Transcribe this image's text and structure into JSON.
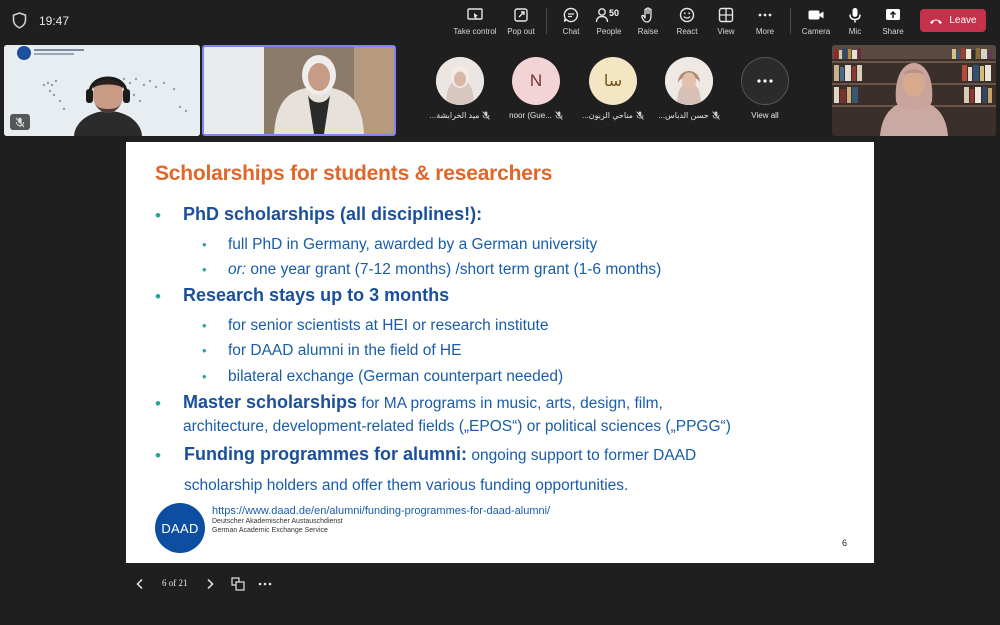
{
  "status": {
    "time": "19:47"
  },
  "toolbar": {
    "take_control": "Take control",
    "pop_out": "Pop out",
    "chat": "Chat",
    "people": "People",
    "people_count": "50",
    "raise": "Raise",
    "react": "React",
    "view": "View",
    "more": "More",
    "camera": "Camera",
    "mic": "Mic",
    "share": "Share",
    "leave": "Leave"
  },
  "participants": [
    {
      "name": "...ميد الخرابشة",
      "kind": "photo"
    },
    {
      "name": "noor (Gue...",
      "kind": "initial",
      "initial": "N"
    },
    {
      "name": "...مناحي الزبون",
      "kind": "initial",
      "initial": "سا"
    },
    {
      "name": "...حسن الدباس",
      "kind": "photo"
    },
    {
      "name": "View all",
      "kind": "more"
    }
  ],
  "slide": {
    "title": "Scholarships for students & researchers",
    "items": [
      {
        "level": 1,
        "text": "PhD scholarships (all disciplines!):"
      },
      {
        "level": 2,
        "text": " full PhD in Germany, awarded by a German university"
      },
      {
        "level": 2,
        "italic_prefix": "or:",
        "text": " one year grant (7-12 months) /short term grant (1-6 months)"
      },
      {
        "level": 1,
        "text": "Research stays up to 3 months"
      },
      {
        "level": 2,
        "text": "for senior scientists at HEI or research institute"
      },
      {
        "level": 2,
        "text": "for DAAD alumni in the field of HE"
      },
      {
        "level": 2,
        "text": "bilateral exchange (German counterpart needed)"
      },
      {
        "level": 1,
        "bold": "Master scholarships",
        "text": " for MA programs in music, arts, design, film,",
        "continuation": "architecture, development-related fields („EPOS“) or political sciences („PPGG“)"
      },
      {
        "level": 1,
        "bold": "Funding programmes for alumni:",
        "text": " ongoing support to former DAAD",
        "continuation": "scholarship holders and offer them various funding opportunities."
      }
    ],
    "logo_text": "DAAD",
    "url": "https://www.daad.de/en/alumni/funding-programmes-for-daad-alumni/",
    "org_de": "Deutscher Akademischer Austauschdienst",
    "org_en": "German Academic Exchange Service",
    "page_number": "6"
  },
  "presenter_controls": {
    "page_indicator": "6 of 21"
  },
  "colors": {
    "leave": "#c4314b",
    "title": "#e0662a",
    "heading": "#1a4f9c",
    "body": "#1a5ca8",
    "bullet": "#2aa39a",
    "active_speaker": "#7f85f5"
  }
}
